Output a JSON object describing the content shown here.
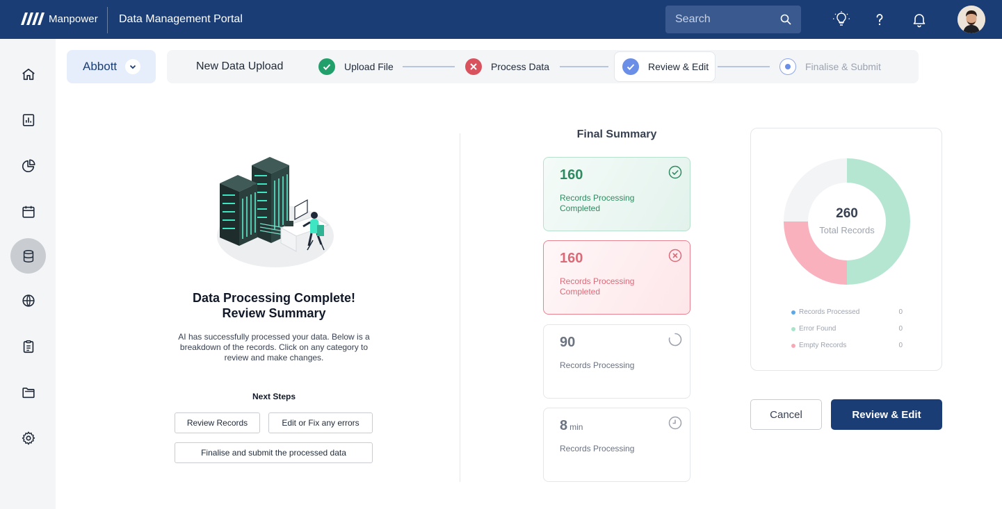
{
  "header": {
    "brand": "Manpower",
    "title": "Data Management Portal",
    "search_placeholder": "Search",
    "icons": [
      "lightbulb-icon",
      "help-icon",
      "bell-icon"
    ]
  },
  "sidebar": {
    "items": [
      {
        "icon": "home-icon"
      },
      {
        "icon": "report-icon"
      },
      {
        "icon": "pie-chart-icon"
      },
      {
        "icon": "calendar-icon"
      },
      {
        "icon": "database-icon",
        "active": true
      },
      {
        "icon": "globe-icon"
      },
      {
        "icon": "clipboard-icon"
      },
      {
        "icon": "folder-icon"
      },
      {
        "icon": "settings-icon"
      }
    ]
  },
  "client": {
    "name": "Abbott"
  },
  "stepper": {
    "title": "New Data Upload",
    "steps": [
      {
        "label": "Upload File",
        "status": "done"
      },
      {
        "label": "Process Data",
        "status": "error"
      },
      {
        "label": "Review & Edit",
        "status": "current"
      },
      {
        "label": "Finalise & Submit",
        "status": "pending"
      }
    ]
  },
  "left": {
    "title_line1": "Data Processing Complete!",
    "title_line2": "Review Summary",
    "description": "AI has successfully processed your data. Below is a breakdown of the records. Click on any category to review and make changes.",
    "next_steps_title": "Next Steps",
    "buttons": {
      "review": "Review Records",
      "fix": "Edit or Fix any errors",
      "finalise": "Finalise and submit the processed data"
    }
  },
  "summary": {
    "title": "Final Summary",
    "cards": [
      {
        "value": "160",
        "unit": "",
        "label": "Records Processing Completed",
        "tone": "green",
        "icon": "check-circle-icon"
      },
      {
        "value": "160",
        "unit": "",
        "label": "Records Processing Completed",
        "tone": "red",
        "icon": "x-circle-icon"
      },
      {
        "value": "90",
        "unit": "",
        "label": "Records Processing",
        "tone": "grey",
        "icon": "spinner-icon"
      },
      {
        "value": "8",
        "unit": "min",
        "label": "Records Processing",
        "tone": "grey",
        "icon": "clock-icon"
      }
    ]
  },
  "chart_data": {
    "type": "pie",
    "center_value": "260",
    "center_label": "Total Records",
    "series": [
      {
        "name": "Records Processed",
        "value": 0,
        "color": "#5aa9e6"
      },
      {
        "name": "Error Found",
        "value": 0,
        "color": "#a9e3cc"
      },
      {
        "name": "Empty Records",
        "value": 0,
        "color": "#f7a8b5"
      }
    ],
    "arcs": [
      {
        "label": "Error Found",
        "fraction": 0.5,
        "color": "#b4e6d2"
      },
      {
        "label": "Empty Records",
        "fraction": 0.25,
        "color": "#f9b1bd"
      },
      {
        "label": "remaining",
        "fraction": 0.25,
        "color": "#f3f4f6"
      }
    ]
  },
  "actions": {
    "cancel": "Cancel",
    "primary": "Review & Edit"
  },
  "colors": {
    "primary": "#1b3d75",
    "success": "#2f8a61",
    "error": "#d96b79"
  }
}
